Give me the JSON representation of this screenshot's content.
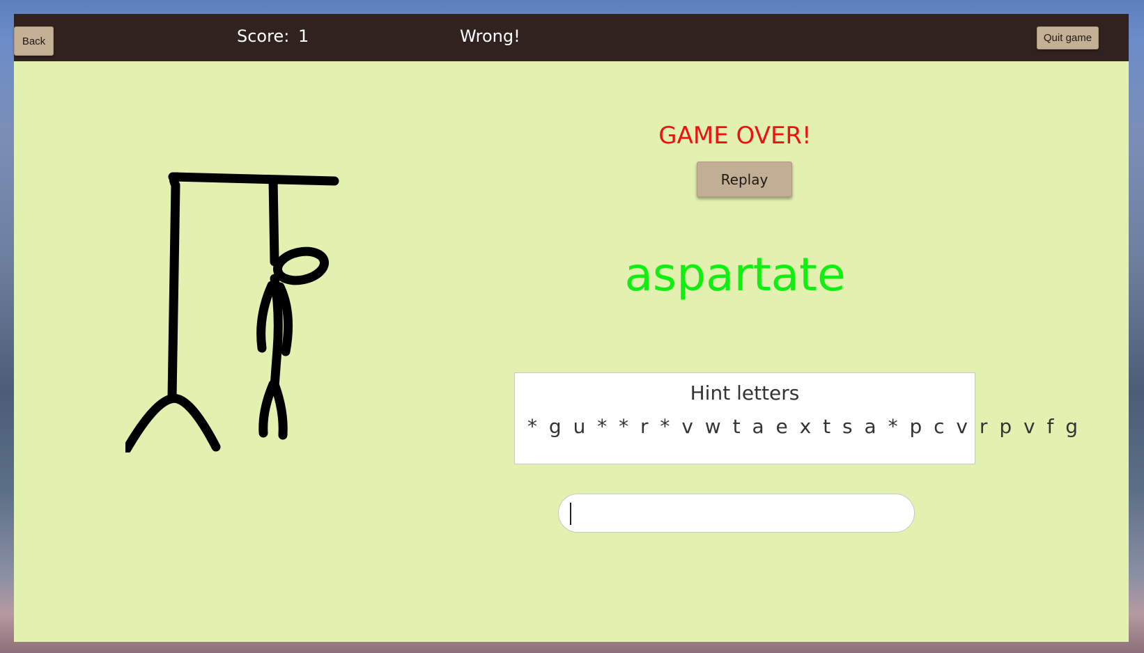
{
  "topbar": {
    "back_label": "Back",
    "score_label": "Score:",
    "score_value": "1",
    "status": "Wrong!",
    "quit_label": "Quit game"
  },
  "game": {
    "result": "GAME OVER!",
    "replay_label": "Replay",
    "answer": "aspartate"
  },
  "hint": {
    "title": "Hint letters",
    "letters": "* g u * * r * v w t a e x t s a * p c v r p v f g"
  },
  "guess": {
    "value": "",
    "placeholder": ""
  },
  "colors": {
    "topbar": "#312220",
    "panel": "#e2f1b0",
    "result": "#ee1111",
    "answer": "#11ee11",
    "button": "#c2ae94"
  }
}
